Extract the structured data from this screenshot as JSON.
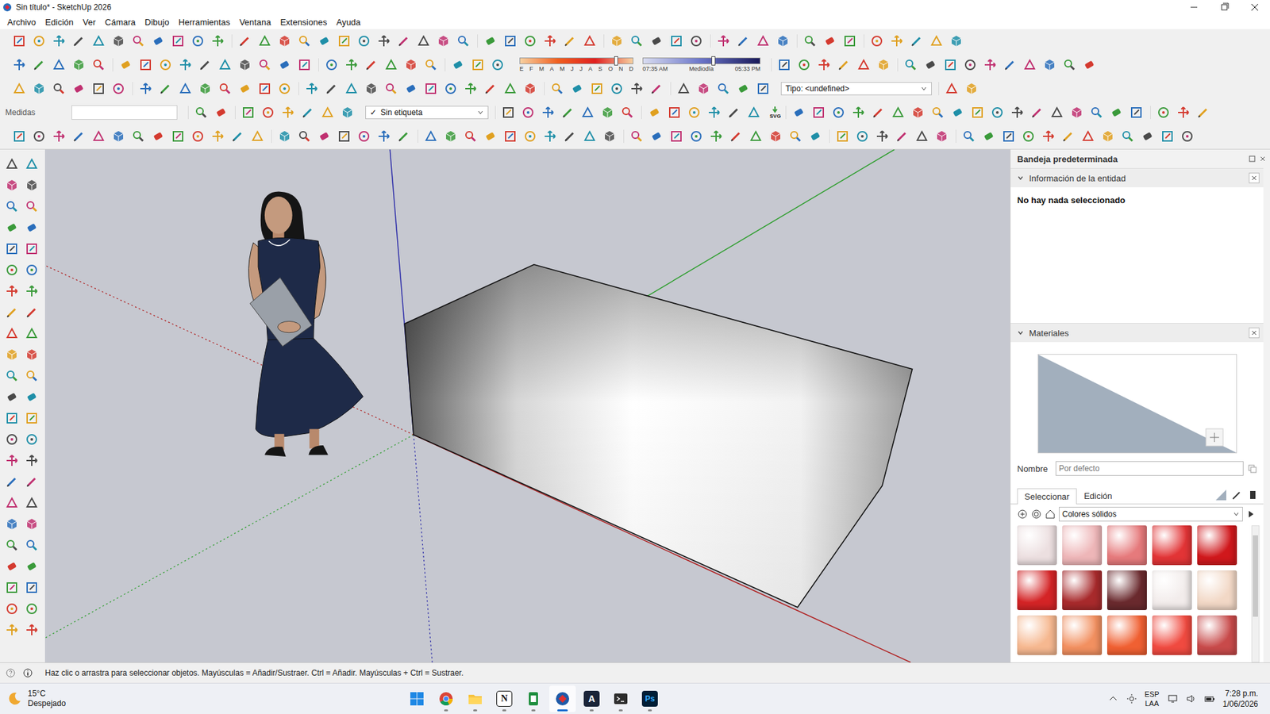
{
  "window": {
    "title": "Sin título* - SketchUp 2026"
  },
  "menu": [
    "Archivo",
    "Edición",
    "Ver",
    "Cámara",
    "Dibujo",
    "Herramientas",
    "Ventana",
    "Extensiones",
    "Ayuda"
  ],
  "toolbar": {
    "measurements": {
      "label": "Medidas",
      "value": ""
    },
    "tag": {
      "check": "✓",
      "label": "Sin etiqueta"
    },
    "type": {
      "label": "Tipo: <undefined>"
    },
    "svg_label": "SVG",
    "shadows": {
      "months": [
        "E",
        "F",
        "M",
        "A",
        "M",
        "J",
        "J",
        "A",
        "S",
        "O",
        "N",
        "D"
      ],
      "month_level": 0.85,
      "time_level": 0.6,
      "times": [
        "07:35 AM",
        "Mediodía",
        "05:33 PM"
      ]
    }
  },
  "tray": {
    "title": "Bandeja predeterminada",
    "entity_info": {
      "title": "Información de la entidad",
      "expanded": true,
      "message": "No hay nada seleccionado"
    },
    "materials": {
      "title": "Materiales",
      "expanded": true,
      "name_label": "Nombre",
      "name_placeholder": "Por defecto",
      "tabs": [
        {
          "label": "Seleccionar",
          "selected": true
        },
        {
          "label": "Edición",
          "selected": false
        }
      ],
      "library": "Colores sólidos",
      "swatches": [
        {
          "color": "#ecdfe0"
        },
        {
          "color": "#eeb6b8"
        },
        {
          "color": "#e67a7c"
        },
        {
          "color": "#e23436"
        },
        {
          "color": "#d0181c"
        },
        {
          "color": "#d42426"
        },
        {
          "color": "#a82a2c"
        },
        {
          "color": "#6a2a2e"
        },
        {
          "color": "#f2eceb"
        },
        {
          "color": "#f2d8c6"
        },
        {
          "color": "#f6b890"
        },
        {
          "color": "#f29060"
        },
        {
          "color": "#f06032"
        },
        {
          "color": "#f04a40"
        },
        {
          "color": "#c84a4a"
        }
      ]
    }
  },
  "status_bar": {
    "hint": "Haz clic o arrastra para seleccionar objetos. Mayúsculas = Añadir/Sustraer. Ctrl = Añadir. Mayúsculas + Ctrl = Sustraer."
  },
  "taskbar": {
    "weather": {
      "temp": "15°C",
      "condition": "Despejado"
    },
    "apps": [
      {
        "kind": "windows",
        "label": "",
        "running": false,
        "selected": false
      },
      {
        "kind": "chrome",
        "label": "",
        "running": true,
        "selected": false
      },
      {
        "kind": "folder",
        "label": "",
        "running": true,
        "selected": false
      },
      {
        "kind": "notion",
        "label": "N",
        "running": true,
        "selected": false
      },
      {
        "kind": "sheet",
        "label": "",
        "running": true,
        "selected": false
      },
      {
        "kind": "sketchup",
        "label": "",
        "running": true,
        "selected": true
      },
      {
        "kind": "autocad",
        "label": "A",
        "running": true,
        "selected": false
      },
      {
        "kind": "terminal",
        "label": "",
        "running": true,
        "selected": false
      },
      {
        "kind": "photoshop",
        "label": "Ps",
        "running": true,
        "selected": false
      }
    ],
    "language": {
      "lang": "ESP",
      "layout": "LAA"
    },
    "time": "7:28 p.m.",
    "date": "1/06/2026"
  }
}
